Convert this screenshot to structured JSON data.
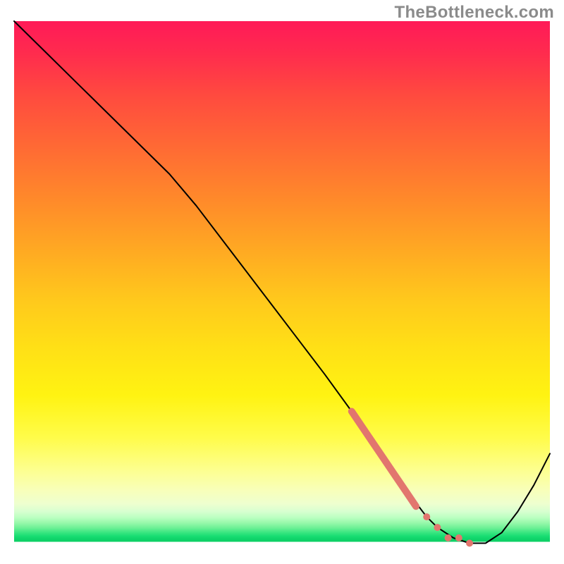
{
  "watermark": "TheBottleneck.com",
  "chart_data": {
    "type": "line",
    "title": "",
    "xlabel": "",
    "ylabel": "",
    "xlim": [
      0,
      100
    ],
    "ylim": [
      0,
      100
    ],
    "grid": false,
    "legend": false,
    "series": [
      {
        "name": "bottleneck-curve",
        "color": "#000000",
        "stroke_width": 2,
        "x": [
          0,
          6,
          12,
          18,
          24,
          29,
          34,
          40,
          46,
          52,
          58,
          63,
          67,
          71,
          74,
          77,
          79,
          82,
          85,
          88,
          91,
          94,
          97,
          100
        ],
        "y": [
          100,
          94,
          88,
          82,
          76,
          71,
          65,
          57,
          49,
          41,
          33,
          26,
          20,
          14,
          10,
          6,
          4,
          2,
          1,
          1,
          3,
          7,
          12,
          18
        ]
      },
      {
        "name": "highlight-segment",
        "color": "#e2766e",
        "stroke_width": 10,
        "style": "solid-then-dot",
        "x": [
          63,
          65,
          67,
          69,
          71,
          73,
          75,
          77,
          79,
          81,
          83,
          85
        ],
        "y": [
          26,
          23,
          20,
          17,
          14,
          11,
          8,
          6,
          4,
          2,
          2,
          1
        ]
      }
    ],
    "background_gradient": {
      "orientation": "vertical",
      "stops": [
        {
          "pct": 0,
          "color": "#ff1a58"
        },
        {
          "pct": 24,
          "color": "#ff6a34"
        },
        {
          "pct": 53,
          "color": "#ffc91c"
        },
        {
          "pct": 79,
          "color": "#fffc4a"
        },
        {
          "pct": 93,
          "color": "#d7ffd0"
        },
        {
          "pct": 98,
          "color": "#0bcf63"
        },
        {
          "pct": 98.7,
          "color": "#ffffff"
        },
        {
          "pct": 100,
          "color": "#ffffff"
        }
      ]
    }
  }
}
